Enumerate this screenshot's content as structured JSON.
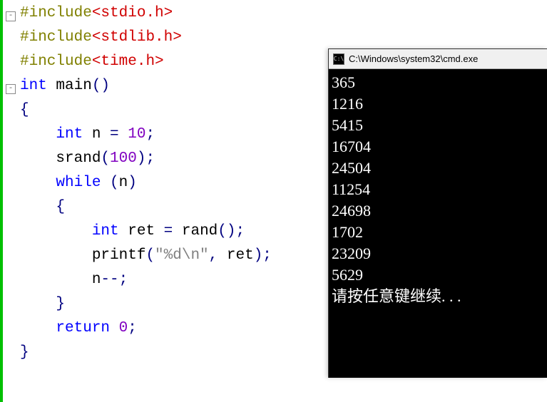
{
  "editor": {
    "lines": [
      {
        "segments": [
          {
            "cls": "kw-pp",
            "t": "#include"
          },
          {
            "cls": "kw-lib",
            "t": "<stdio.h>"
          }
        ],
        "fold": "-"
      },
      {
        "segments": [
          {
            "cls": "kw-pp",
            "t": "#include"
          },
          {
            "cls": "kw-lib",
            "t": "<stdlib.h>"
          }
        ]
      },
      {
        "segments": [
          {
            "cls": "kw-pp",
            "t": "#include"
          },
          {
            "cls": "kw-lib",
            "t": "<time.h>"
          }
        ]
      },
      {
        "segments": [
          {
            "cls": "kw-blue",
            "t": "int"
          },
          {
            "cls": "plain",
            "t": " main"
          },
          {
            "cls": "op",
            "t": "()"
          }
        ],
        "fold": "-"
      },
      {
        "segments": [
          {
            "cls": "op",
            "t": "{"
          }
        ]
      },
      {
        "segments": [
          {
            "cls": "plain",
            "t": "    "
          },
          {
            "cls": "kw-blue",
            "t": "int"
          },
          {
            "cls": "plain",
            "t": " n "
          },
          {
            "cls": "op",
            "t": "="
          },
          {
            "cls": "plain",
            "t": " "
          },
          {
            "cls": "kw-purple",
            "t": "10"
          },
          {
            "cls": "op",
            "t": ";"
          }
        ]
      },
      {
        "segments": [
          {
            "cls": "plain",
            "t": "    srand"
          },
          {
            "cls": "op",
            "t": "("
          },
          {
            "cls": "kw-purple",
            "t": "100"
          },
          {
            "cls": "op",
            "t": ");"
          }
        ]
      },
      {
        "segments": [
          {
            "cls": "plain",
            "t": "    "
          },
          {
            "cls": "kw-blue",
            "t": "while"
          },
          {
            "cls": "plain",
            "t": " "
          },
          {
            "cls": "op",
            "t": "("
          },
          {
            "cls": "plain",
            "t": "n"
          },
          {
            "cls": "op",
            "t": ")"
          }
        ]
      },
      {
        "segments": [
          {
            "cls": "plain",
            "t": "    "
          },
          {
            "cls": "op",
            "t": "{"
          }
        ]
      },
      {
        "segments": [
          {
            "cls": "plain",
            "t": "        "
          },
          {
            "cls": "kw-blue",
            "t": "int"
          },
          {
            "cls": "plain",
            "t": " ret "
          },
          {
            "cls": "op",
            "t": "="
          },
          {
            "cls": "plain",
            "t": " rand"
          },
          {
            "cls": "op",
            "t": "();"
          }
        ]
      },
      {
        "segments": [
          {
            "cls": "plain",
            "t": "        printf"
          },
          {
            "cls": "op",
            "t": "("
          },
          {
            "cls": "str",
            "t": "\"%d\\n\""
          },
          {
            "cls": "op",
            "t": ","
          },
          {
            "cls": "plain",
            "t": " ret"
          },
          {
            "cls": "op",
            "t": ");"
          }
        ]
      },
      {
        "segments": [
          {
            "cls": "plain",
            "t": "        n"
          },
          {
            "cls": "op",
            "t": "--;"
          }
        ]
      },
      {
        "segments": [
          {
            "cls": "plain",
            "t": "    "
          },
          {
            "cls": "op",
            "t": "}"
          }
        ]
      },
      {
        "segments": [
          {
            "cls": "plain",
            "t": "    "
          },
          {
            "cls": "kw-blue",
            "t": "return"
          },
          {
            "cls": "plain",
            "t": " "
          },
          {
            "cls": "kw-purple",
            "t": "0"
          },
          {
            "cls": "op",
            "t": ";"
          }
        ]
      },
      {
        "segments": [
          {
            "cls": "op",
            "t": "}"
          }
        ]
      }
    ]
  },
  "console": {
    "title": "C:\\Windows\\system32\\cmd.exe",
    "icon_text": "C:\\",
    "output": [
      "365",
      "1216",
      "5415",
      "16704",
      "24504",
      "11254",
      "24698",
      "1702",
      "23209",
      "5629"
    ],
    "prompt": "请按任意键继续. . ."
  }
}
